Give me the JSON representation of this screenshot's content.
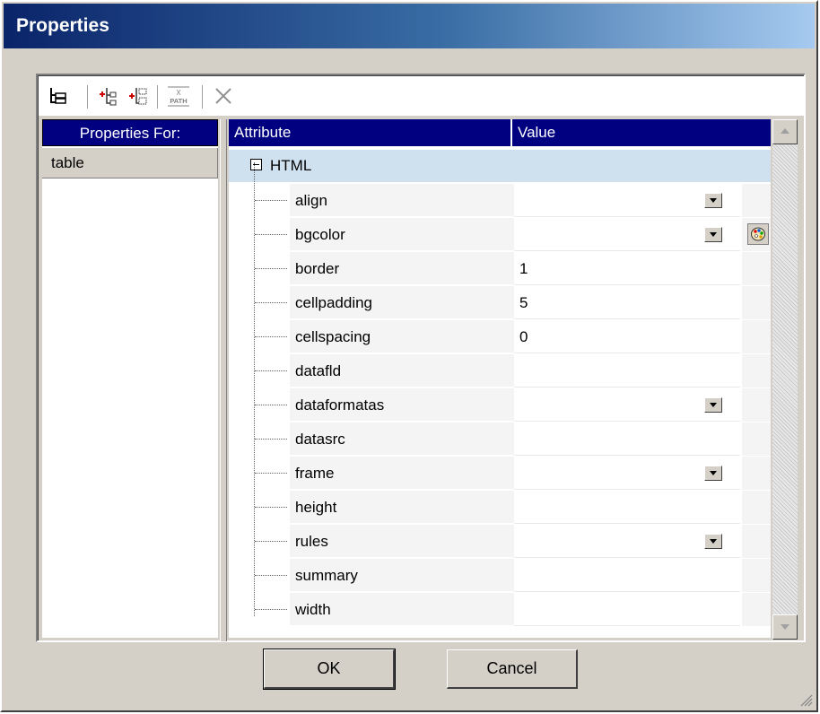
{
  "window": {
    "title": "Properties"
  },
  "toolbar": {
    "items": [
      "tree-view-icon",
      "add-child-icon",
      "add-sibling-icon",
      "xpath-icon",
      "delete-icon"
    ],
    "xpath_label_top": "X",
    "xpath_label_bottom": "PATH"
  },
  "left_pane": {
    "header": "Properties For:",
    "items": [
      {
        "label": "table"
      }
    ]
  },
  "grid": {
    "headers": {
      "attribute": "Attribute",
      "value": "Value"
    },
    "root": "HTML",
    "rows": [
      {
        "attr": "align",
        "value": "",
        "dropdown": true,
        "color_picker": false
      },
      {
        "attr": "bgcolor",
        "value": "",
        "dropdown": true,
        "color_picker": true
      },
      {
        "attr": "border",
        "value": "1",
        "dropdown": false,
        "color_picker": false
      },
      {
        "attr": "cellpadding",
        "value": "5",
        "dropdown": false,
        "color_picker": false
      },
      {
        "attr": "cellspacing",
        "value": "0",
        "dropdown": false,
        "color_picker": false
      },
      {
        "attr": "datafld",
        "value": "",
        "dropdown": false,
        "color_picker": false
      },
      {
        "attr": "dataformatas",
        "value": "",
        "dropdown": true,
        "color_picker": false
      },
      {
        "attr": "datasrc",
        "value": "",
        "dropdown": false,
        "color_picker": false
      },
      {
        "attr": "frame",
        "value": "",
        "dropdown": true,
        "color_picker": false
      },
      {
        "attr": "height",
        "value": "",
        "dropdown": false,
        "color_picker": false
      },
      {
        "attr": "rules",
        "value": "",
        "dropdown": true,
        "color_picker": false
      },
      {
        "attr": "summary",
        "value": "",
        "dropdown": false,
        "color_picker": false
      },
      {
        "attr": "width",
        "value": "",
        "dropdown": false,
        "color_picker": false
      }
    ]
  },
  "buttons": {
    "ok": "OK",
    "cancel": "Cancel"
  },
  "colors": {
    "title_start": "#0a246a",
    "title_end": "#a6caf0",
    "header_bg": "#000080",
    "root_row_bg": "#cfe1ef",
    "dialog_bg": "#d4d0c8"
  }
}
